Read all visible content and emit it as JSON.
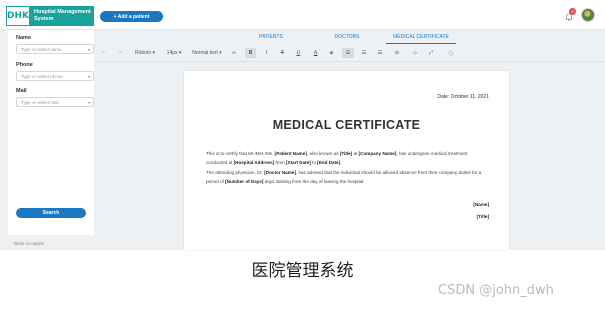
{
  "app": {
    "logo": "DHK",
    "logo_title": "Hospital Management System",
    "add_patient_label": "+ Add a patient",
    "notification_count": "9"
  },
  "sidebar": {
    "fields": [
      {
        "label": "Name",
        "placeholder": "Type or select name"
      },
      {
        "label": "Phone",
        "placeholder": "Type or select phone"
      },
      {
        "label": "Mail",
        "placeholder": "Type or select mail"
      }
    ],
    "search_label": "Search",
    "footer_text": "Beds occupied"
  },
  "tabs": [
    {
      "label": "PATIENTS",
      "active": false
    },
    {
      "label": "DOCTORS",
      "active": false
    },
    {
      "label": "MEDICAL CERTIFICATE",
      "active": true
    }
  ],
  "toolbar": {
    "undo_icon": "undo-icon",
    "redo_icon": "redo-icon",
    "font": "Roboto",
    "size": "14px",
    "style": "Normal text"
  },
  "document": {
    "date_line": "Date: October 11, 2021",
    "title": "MEDICAL CERTIFICATE",
    "p1": {
      "t1": "This is to certify that Mr./Mrs./Ms. ",
      "b1": "[Patient Name]",
      "t2": ", also known as ",
      "b2": "[Title]",
      "t3": " at ",
      "b3": "[Company Name]",
      "t4": ", has undergone medical treatment conducted at ",
      "b4": "[Hospital Address]",
      "t5": " from ",
      "b5": "[Start Date]",
      "t6": " to ",
      "b6": "[End Date]",
      "t7": "."
    },
    "p2": {
      "t1": "The attending physician, Dr. ",
      "b1": "[Doctor Name]",
      "t2": ", has advised that the individual should be allowed absence from their company duties for a period of ",
      "b2": "[Number of Days]",
      "t3": " days starting from the day of leaving the hospital."
    },
    "sign_name": "[Name]",
    "sign_title": "[Title]"
  },
  "caption": "医院管理系统",
  "watermark": "CSDN @john_dwh"
}
